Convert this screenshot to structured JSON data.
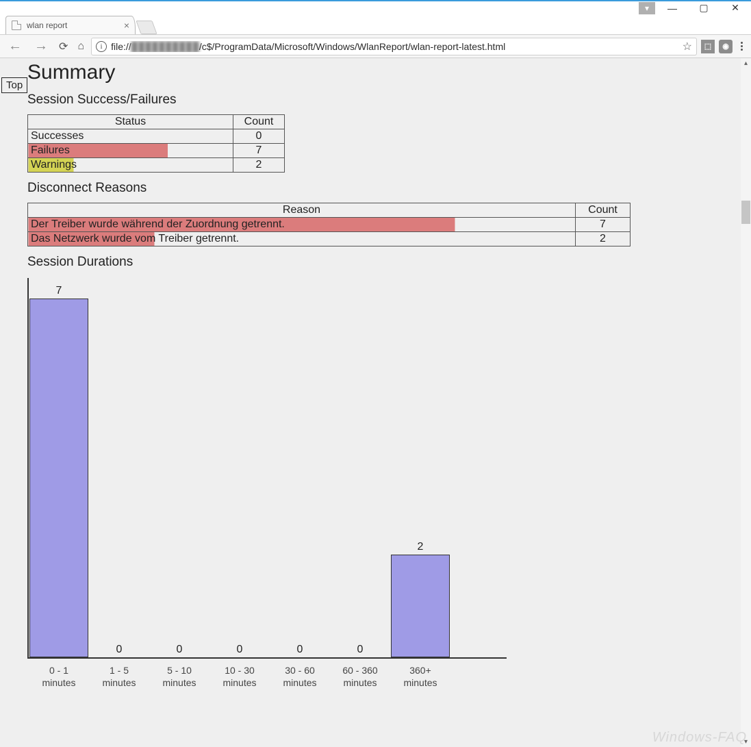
{
  "window": {
    "tab_title": "wlan report",
    "url_prefix": "file://",
    "url_blurred": "██████████",
    "url_path": "/c$/ProgramData/Microsoft/Windows/WlanReport/wlan-report-latest.html"
  },
  "page": {
    "top_link": "Top",
    "heading_summary": "Summary",
    "heading_sessions": "Session Success/Failures",
    "heading_disconnect": "Disconnect Reasons",
    "heading_durations": "Session Durations",
    "watermark": "Windows-FAQ"
  },
  "session_table": {
    "col_status": "Status",
    "col_count": "Count",
    "rows": [
      {
        "label": "Successes",
        "count": "0",
        "fill_pct": 0,
        "fill": "none"
      },
      {
        "label": "Failures",
        "count": "7",
        "fill_pct": 68,
        "fill": "red"
      },
      {
        "label": "Warnings",
        "count": "2",
        "fill_pct": 22,
        "fill": "yellow"
      }
    ]
  },
  "disconnect_table": {
    "col_reason": "Reason",
    "col_count": "Count",
    "rows": [
      {
        "label": "Der Treiber wurde während der Zuordnung getrennt.",
        "count": "7",
        "fill_pct": 78
      },
      {
        "label": "Das Netzwerk wurde vom Treiber getrennt.",
        "count": "2",
        "fill_pct": 23
      }
    ]
  },
  "chart_data": {
    "type": "bar",
    "title": "Session Durations",
    "xlabel": "",
    "ylabel": "",
    "ylim": [
      0,
      7
    ],
    "categories": [
      "0 - 1 minutes",
      "1 - 5 minutes",
      "5 - 10 minutes",
      "10 - 30 minutes",
      "30 - 60 minutes",
      "60 - 360 minutes",
      "360+ minutes"
    ],
    "values": [
      7,
      0,
      0,
      0,
      0,
      0,
      2
    ],
    "bar_color": "#9f9be6"
  }
}
